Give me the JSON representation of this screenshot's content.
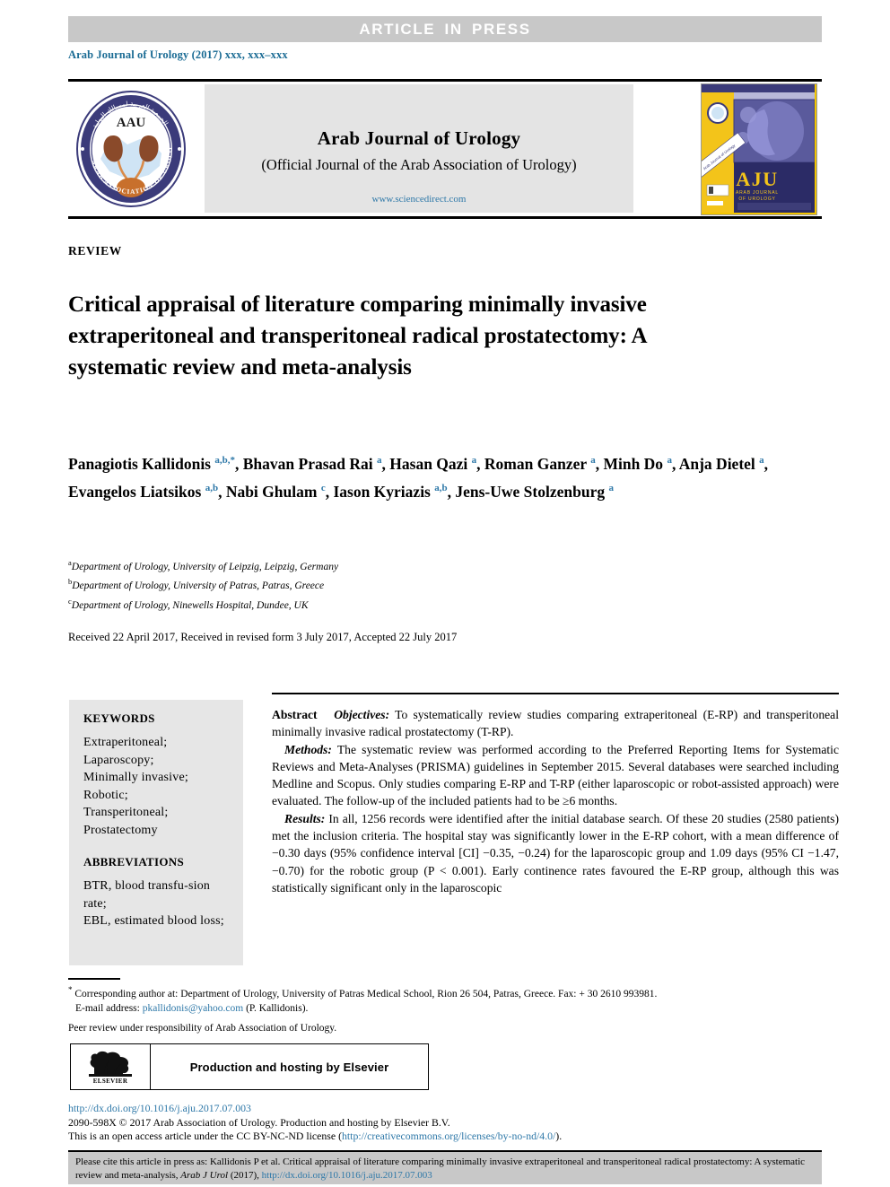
{
  "press_band": {
    "label": "ARTICLE  IN  PRESS"
  },
  "running_head": {
    "text": "Arab Journal of Urology (2017) xxx, xxx–xxx"
  },
  "masthead": {
    "journal_title": "Arab Journal of Urology",
    "journal_subtitle": "(Official Journal of the Arab Association of Urology)",
    "url": "www.sciencedirect.com",
    "logo_text": "AAU",
    "logo_ring_top": "الجمعية العربية لمسالك البولية",
    "logo_ring_bottom": "ARAB ASSOCIATION OF UROLOGY",
    "cover_title": "AJU",
    "cover_sub1": "ARAB JOURNAL",
    "cover_sub2": "OF UROLOGY"
  },
  "article": {
    "type_label": "REVIEW",
    "title": "Critical appraisal of literature comparing minimally invasive extraperitoneal and transperitoneal radical prostatectomy: A systematic review and meta-analysis",
    "authors": [
      {
        "name": "Panagiotis Kallidonis",
        "marks": "a,b,*",
        "sep": ", "
      },
      {
        "name": "Bhavan Prasad Rai",
        "marks": "a",
        "sep": ", "
      },
      {
        "name": "Hasan Qazi",
        "marks": "a",
        "sep": ", "
      },
      {
        "name": "Roman Ganzer",
        "marks": "a",
        "sep": ", "
      },
      {
        "name": "Minh Do",
        "marks": "a",
        "sep": ", "
      },
      {
        "name": "Anja Dietel",
        "marks": "a",
        "sep": ", "
      },
      {
        "name": "Evangelos Liatsikos",
        "marks": "a,b",
        "sep": ", "
      },
      {
        "name": "Nabi Ghulam",
        "marks": "c",
        "sep": ", "
      },
      {
        "name": "Iason Kyriazis",
        "marks": "a,b",
        "sep": ", "
      },
      {
        "name": "Jens-Uwe Stolzenburg",
        "marks": "a",
        "sep": ""
      }
    ],
    "affiliations": [
      {
        "mark": "a",
        "text": "Department of Urology, University of Leipzig, Leipzig, Germany"
      },
      {
        "mark": "b",
        "text": "Department of Urology, University of Patras, Patras, Greece"
      },
      {
        "mark": "c",
        "text": "Department of Urology, Ninewells Hospital, Dundee, UK"
      }
    ],
    "received_line": "Received 22 April 2017, Received in revised form 3 July 2017, Accepted 22 July 2017"
  },
  "keywords": {
    "heading": "KEYWORDS",
    "items": [
      "Extraperitoneal;",
      "Laparoscopy;",
      "Minimally invasive;",
      "Robotic;",
      "Transperitoneal;",
      "Prostatectomy"
    ]
  },
  "abbreviations": {
    "heading": "ABBREVIATIONS",
    "items": [
      "BTR, blood transfu-sion rate;",
      "EBL, estimated blood loss;"
    ]
  },
  "abstract": {
    "label": "Abstract",
    "objectives_label": "Objectives:",
    "objectives_text": "To systematically review studies comparing extraperitoneal (E-RP) and transperitoneal minimally invasive radical prostatectomy (T-RP).",
    "methods_label": "Methods:",
    "methods_text": "The systematic review was performed according to the Preferred Reporting Items for Systematic Reviews and Meta-Analyses (PRISMA) guidelines in September 2015. Several databases were searched including Medline and Scopus. Only studies comparing E-RP and T-RP (either laparoscopic or robot-assisted approach) were evaluated. The follow-up of the included patients had to be ≥6 months.",
    "results_label": "Results:",
    "results_text": "In all, 1256 records were identified after the initial database search. Of these 20 studies (2580 patients) met the inclusion criteria. The hospital stay was significantly lower in the E-RP cohort, with a mean difference of −0.30 days (95% confidence interval [CI] −0.35, −0.24) for the laparoscopic group and 1.09 days (95% CI −1.47, −0.70) for the robotic group (P < 0.001). Early continence rates favoured the E-RP group, although this was statistically significant only in the laparoscopic"
  },
  "footnotes": {
    "corresponding": "Corresponding author at: Department of Urology, University of Patras Medical School, Rion 26 504, Patras, Greece. Fax: + 30 2610 993981.",
    "email_label": "E-mail address:",
    "email": "pkallidonis@yahoo.com",
    "email_owner": "(P. Kallidonis).",
    "peer_review": "Peer review under responsibility of Arab Association of Urology."
  },
  "elsevier": {
    "wordmark": "ELSEVIER",
    "production_text": "Production and hosting by Elsevier"
  },
  "doi_footer": {
    "doi_url": "http://dx.doi.org/10.1016/j.aju.2017.07.003",
    "copyright": "2090-598X © 2017 Arab Association of Urology. Production and hosting by Elsevier B.V.",
    "license_prefix": "This is an open access article under the CC BY-NC-ND license (",
    "license_url": "http://creativecommons.org/licenses/by-no-nd/4.0/",
    "license_suffix": ")."
  },
  "citation_box": {
    "prefix": "Please cite this article in press as: Kallidonis P et al. Critical appraisal of literature comparing minimally invasive extraperitoneal and transperitoneal radical prostatectomy: A systematic review and meta-analysis,",
    "journal_abbrev": "Arab J Urol",
    "year": "(2017),",
    "url": "http://dx.doi.org/10.1016/j.aju.2017.07.003"
  },
  "colors": {
    "band_grey": "#c8c8c8",
    "panel_grey": "#e4e4e4",
    "link_blue": "#2e78a8",
    "header_blue": "#1a6b94"
  }
}
